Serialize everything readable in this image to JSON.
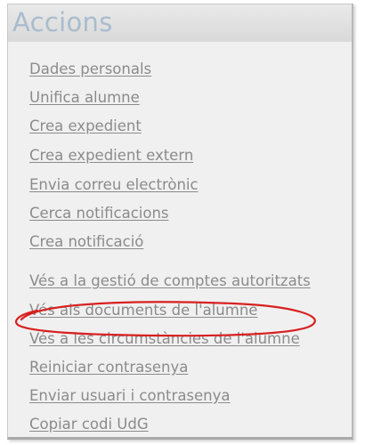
{
  "panel": {
    "title": "Accions"
  },
  "actions": {
    "group1": [
      "Dades personals",
      "Unifica alumne",
      "Crea expedient",
      "Crea expedient extern",
      "Envia correu electrònic",
      "Cerca notificacions",
      "Crea notificació"
    ],
    "group2": [
      "Vés a la gestió de comptes autoritzats",
      "Vés als documents de l'alumne",
      "Vés a les circumstàncies de l'alumne",
      "Reiniciar contrasenya",
      "Enviar usuari i contrasenya",
      "Copiar codi UdG"
    ]
  },
  "colors": {
    "title": "#a9bccd",
    "link": "#8b8b8b",
    "highlight_ellipse": "#d82020"
  }
}
